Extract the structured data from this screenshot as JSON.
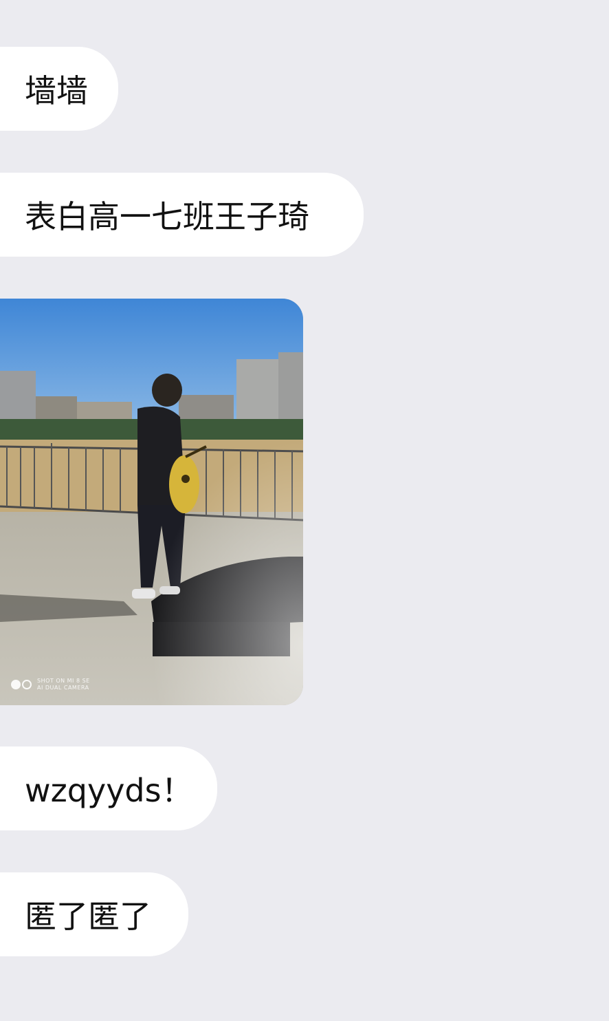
{
  "chat": {
    "messages": [
      {
        "type": "text",
        "text": "墙墙"
      },
      {
        "type": "text",
        "text": "表白高一七班王子琦"
      },
      {
        "type": "image",
        "description": ""
      },
      {
        "type": "text",
        "text": "wzqyyds！"
      },
      {
        "type": "text",
        "text": "匿了匿了"
      }
    ],
    "photo_watermark": {
      "line1": "SHOT ON MI 8 SE",
      "line2": "AI DUAL CAMERA"
    }
  },
  "colors": {
    "background": "#ebebf0",
    "bubble": "#ffffff",
    "text": "#111111"
  }
}
